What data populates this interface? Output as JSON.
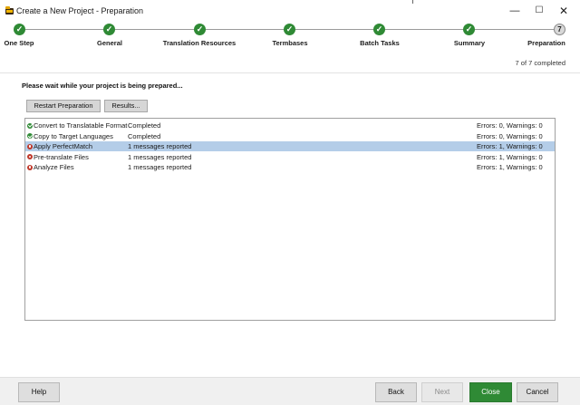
{
  "window": {
    "title": "Create a New Project - Preparation",
    "minimize_glyph": "—",
    "maximize_glyph": "☐",
    "close_glyph": "✕"
  },
  "steps": [
    {
      "label": "One Step",
      "state": "done",
      "marker": "✓"
    },
    {
      "label": "General",
      "state": "done",
      "marker": "✓"
    },
    {
      "label": "Translation Resources",
      "state": "done",
      "marker": "✓"
    },
    {
      "label": "Termbases",
      "state": "done",
      "marker": "✓"
    },
    {
      "label": "Batch Tasks",
      "state": "done",
      "marker": "✓"
    },
    {
      "label": "Summary",
      "state": "done",
      "marker": "✓"
    },
    {
      "label": "Preparation",
      "state": "current",
      "marker": "7"
    }
  ],
  "progress": {
    "text": "7 of 7 completed",
    "completed": 7,
    "total": 7
  },
  "main": {
    "wait_message": "Please wait while your project is being prepared...",
    "restart_label": "Restart Preparation",
    "results_label": "Results..."
  },
  "tasks": [
    {
      "name": "Convert to Translatable Format",
      "status": "Completed",
      "errors": "Errors: 0, Warnings: 0",
      "icon": "success-icon",
      "selected": false
    },
    {
      "name": "Copy to Target Languages",
      "status": "Completed",
      "errors": "Errors: 0, Warnings: 0",
      "icon": "success-icon",
      "selected": false
    },
    {
      "name": "Apply PerfectMatch",
      "status": "1 messages reported",
      "errors": "Errors: 1, Warnings: 0",
      "icon": "error-icon",
      "selected": true
    },
    {
      "name": "Pre-translate Files",
      "status": "1 messages reported",
      "errors": "Errors: 1, Warnings: 0",
      "icon": "error-icon",
      "selected": false
    },
    {
      "name": "Analyze Files",
      "status": "1 messages reported",
      "errors": "Errors: 1, Warnings: 0",
      "icon": "error-icon",
      "selected": false
    }
  ],
  "footer": {
    "help_label": "Help",
    "back_label": "Back",
    "next_label": "Next",
    "close_label": "Close",
    "cancel_label": "Cancel"
  },
  "colors": {
    "accent_green": "#2f8a35",
    "selection_blue": "#b4cde8",
    "error_red": "#c0392b"
  }
}
